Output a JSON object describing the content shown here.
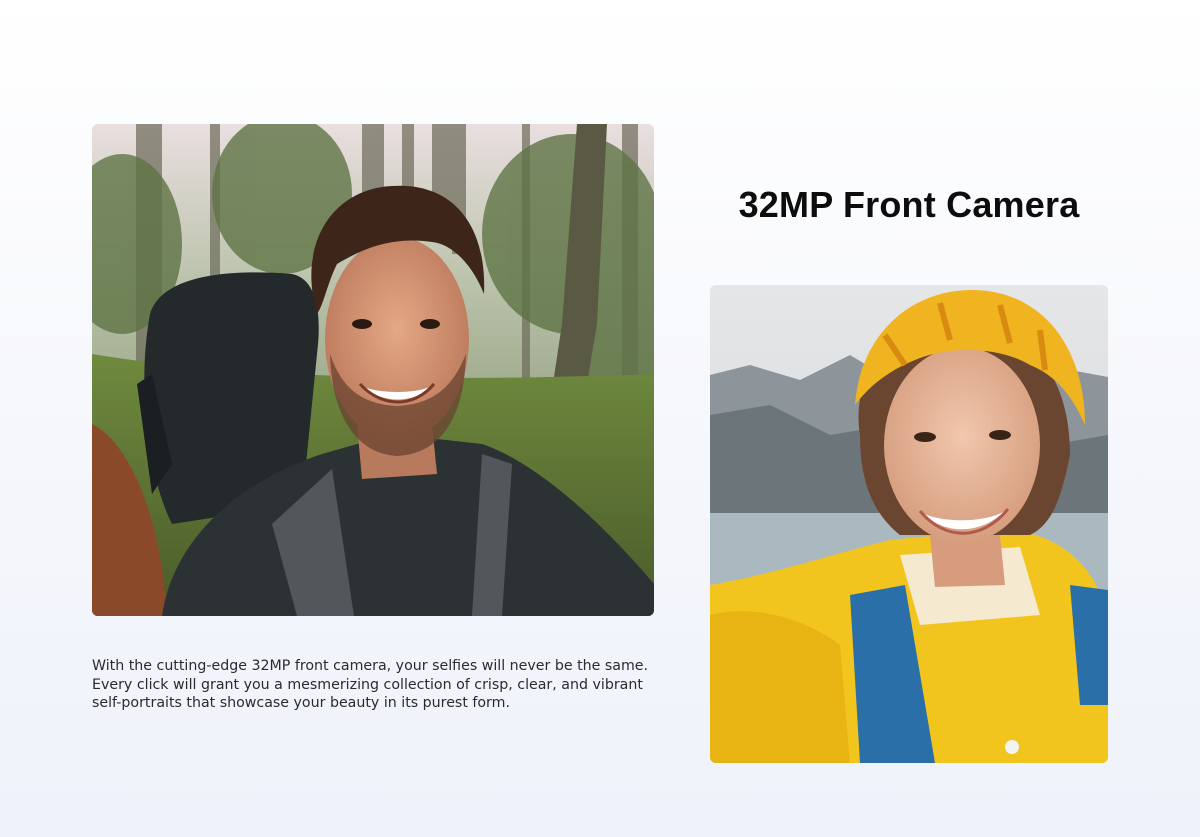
{
  "section": {
    "title": "32MP Front Camera",
    "description_lines": [
      "With the cutting-edge 32MP front camera, your selfies will never be the same.",
      "Every click will grant you a mesmerizing collection of crisp, clear, and vibrant",
      "self-portraits that showcase your beauty in its purest form."
    ]
  },
  "colors": {
    "title_text": "#0d0d0d",
    "body_text": "#2b2b2b",
    "page_background": "#f4f6fb"
  }
}
